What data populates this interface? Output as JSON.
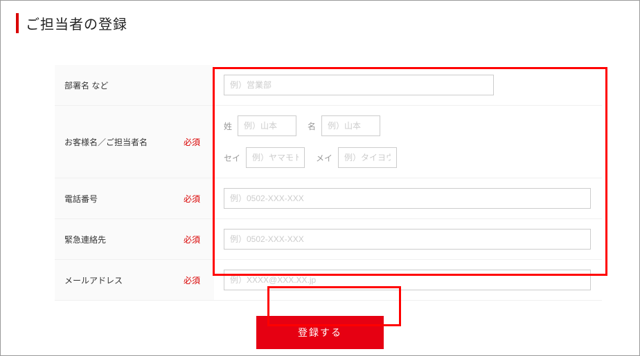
{
  "page": {
    "title": "ご担当者の登録"
  },
  "labels": {
    "required": "必須",
    "surname": "姓",
    "givenname": "名",
    "surname_kana": "セイ",
    "givenname_kana": "メイ"
  },
  "fields": {
    "department": {
      "label": "部署名 など",
      "placeholder": "例）営業部",
      "required": false
    },
    "contact_name": {
      "label": "お客様名／ご担当者名",
      "required": true,
      "surname_placeholder": "例）山本",
      "givenname_placeholder": "例）山本",
      "surname_kana_placeholder": "例）ヤマモト",
      "givenname_kana_placeholder": "例）タイヨウ"
    },
    "phone": {
      "label": "電話番号",
      "placeholder": "例）0502-XXX-XXX",
      "required": true
    },
    "emergency": {
      "label": "緊急連絡先",
      "placeholder": "例）0502-XXX-XXX",
      "required": true
    },
    "email": {
      "label": "メールアドレス",
      "placeholder": "例）XXXX@XXX.XX.jp",
      "required": true
    }
  },
  "buttons": {
    "submit": "登録する"
  }
}
